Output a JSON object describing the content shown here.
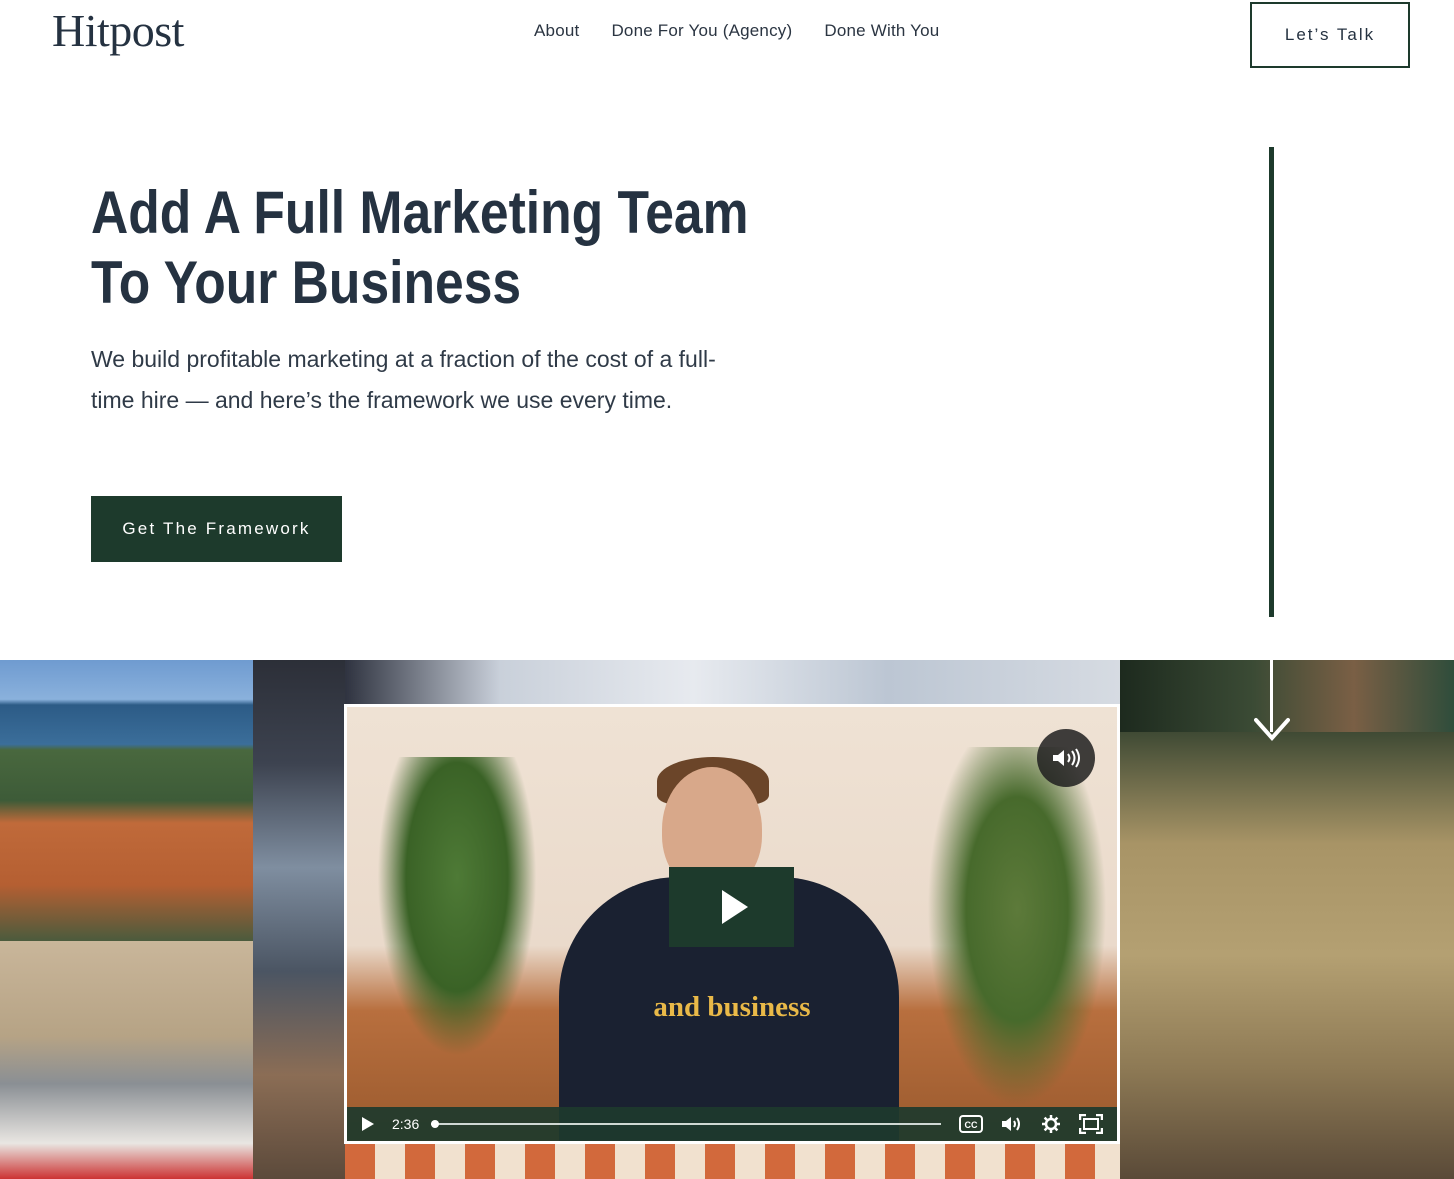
{
  "header": {
    "logo": "Hitpost",
    "nav": [
      {
        "label": "About"
      },
      {
        "label": "Done For You (Agency)"
      },
      {
        "label": "Done With You"
      }
    ],
    "cta_label": "Let’s Talk"
  },
  "hero": {
    "title_line1": "Add A Full Marketing Team",
    "title_line2": "To Your Business",
    "subtitle": "We build profitable marketing at a fraction of the cost of a full-time hire — and here’s the framework we use every time.",
    "cta_label": "Get The Framework"
  },
  "video": {
    "caption": "and business",
    "time": "2:36",
    "progress": 0.0,
    "icons": [
      "play-icon",
      "volume-icon",
      "closed-captions-icon",
      "settings-gear-icon",
      "fullscreen-icon"
    ]
  },
  "colors": {
    "brand_green": "#1d3a2c",
    "heading_navy": "#253241",
    "caption_gold": "#e9b948"
  }
}
